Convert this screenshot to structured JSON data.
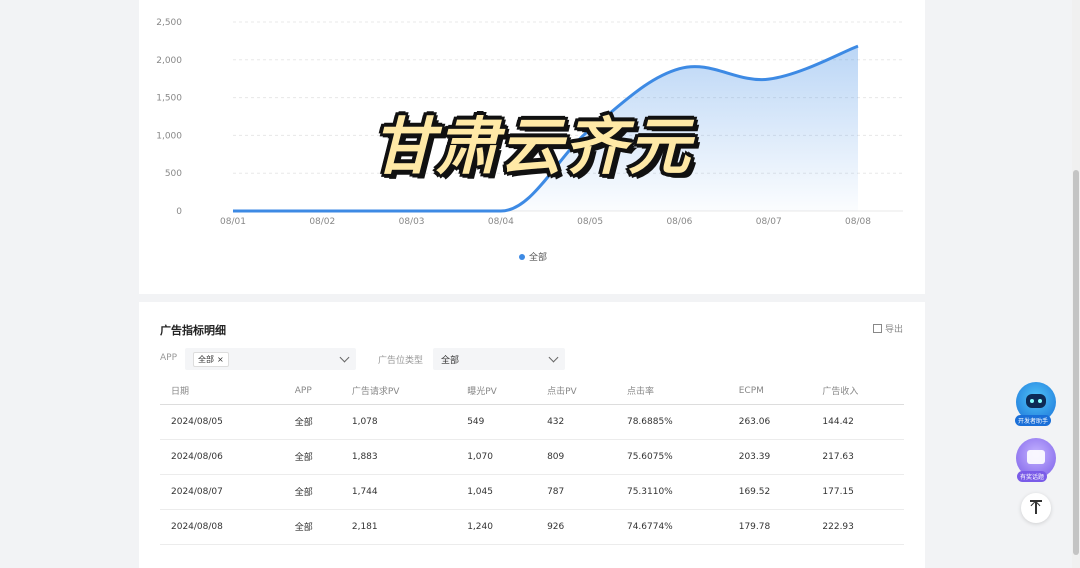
{
  "chart": {
    "legend": "全部",
    "overlay_text": "甘肃云齐元"
  },
  "chart_data": {
    "type": "area",
    "x": [
      "08/01",
      "08/02",
      "08/03",
      "08/04",
      "08/05",
      "08/06",
      "08/07",
      "08/08"
    ],
    "series": [
      {
        "name": "全部",
        "values": [
          0,
          0,
          0,
          0,
          1078,
          1883,
          1744,
          2181
        ]
      }
    ],
    "yticks": [
      "0",
      "500",
      "1,000",
      "1,500",
      "2,000",
      "2,500"
    ],
    "ylim": [
      0,
      2500
    ],
    "color": "#3d8ae4",
    "grid": true,
    "legend_position": "bottom"
  },
  "details": {
    "title": "广告指标明细",
    "export_label": "导出",
    "filters": {
      "app_label": "APP",
      "app_tag": "全部",
      "slot_label": "广告位类型",
      "slot_value": "全部"
    },
    "columns": [
      "日期",
      "APP",
      "广告请求PV",
      "曝光PV",
      "点击PV",
      "点击率",
      "ECPM",
      "广告收入"
    ],
    "rows": [
      [
        "2024/08/05",
        "全部",
        "1,078",
        "549",
        "432",
        "78.6885%",
        "263.06",
        "144.42"
      ],
      [
        "2024/08/06",
        "全部",
        "1,883",
        "1,070",
        "809",
        "75.6075%",
        "203.39",
        "217.63"
      ],
      [
        "2024/08/07",
        "全部",
        "1,744",
        "1,045",
        "787",
        "75.3110%",
        "169.52",
        "177.15"
      ],
      [
        "2024/08/08",
        "全部",
        "2,181",
        "1,240",
        "926",
        "74.6774%",
        "179.78",
        "222.93"
      ]
    ]
  },
  "floating": {
    "assistant_label": "开发者助手",
    "feedback_label": "有奖话题"
  }
}
